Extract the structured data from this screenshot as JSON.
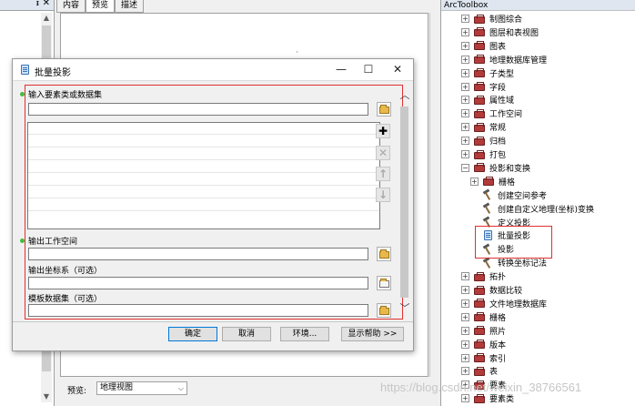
{
  "left_pane": {
    "pin_glyph": "ᵻ",
    "close_glyph": "✕",
    "up": "▲",
    "down": "▼"
  },
  "center_pane": {
    "tabs": [
      {
        "label": "内容",
        "active": false
      },
      {
        "label": "预览",
        "active": true
      },
      {
        "label": "描述",
        "active": false
      }
    ],
    "footer": {
      "preview_label": "预览:",
      "preview_value": "地理视图",
      "chevron": "⌵"
    },
    "placeholder_mark": "·"
  },
  "toolbox": {
    "title": "ArcToolbox",
    "items": [
      {
        "label": "制图综合",
        "expander": "+",
        "icon": "toolbox-icon"
      },
      {
        "label": "图层和表视图",
        "expander": "+",
        "icon": "toolbox-icon"
      },
      {
        "label": "图表",
        "expander": "+",
        "icon": "toolbox-icon"
      },
      {
        "label": "地理数据库管理",
        "expander": "+",
        "icon": "toolbox-icon"
      },
      {
        "label": "子类型",
        "expander": "+",
        "icon": "toolbox-icon"
      },
      {
        "label": "字段",
        "expander": "+",
        "icon": "toolbox-icon"
      },
      {
        "label": "属性域",
        "expander": "+",
        "icon": "toolbox-icon"
      },
      {
        "label": "工作空间",
        "expander": "+",
        "icon": "toolbox-icon"
      },
      {
        "label": "常规",
        "expander": "+",
        "icon": "toolbox-icon"
      },
      {
        "label": "归档",
        "expander": "+",
        "icon": "toolbox-icon"
      },
      {
        "label": "打包",
        "expander": "+",
        "icon": "toolbox-icon"
      },
      {
        "label": "投影和变换",
        "expander": "−",
        "icon": "toolbox-icon"
      },
      {
        "label": "栅格",
        "expander": "+",
        "icon": "toolbox-icon",
        "indent": 1
      },
      {
        "label": "创建空间参考",
        "expander": "",
        "icon": "hammer-icon",
        "indent": 2
      },
      {
        "label": "创建自定义地理(坐标)变换",
        "expander": "",
        "icon": "hammer-icon",
        "indent": 2
      },
      {
        "label": "定义投影",
        "expander": "",
        "icon": "hammer-icon",
        "indent": 2
      },
      {
        "label": "批量投影",
        "expander": "",
        "icon": "script-icon",
        "indent": 2
      },
      {
        "label": "投影",
        "expander": "",
        "icon": "hammer-icon",
        "indent": 2
      },
      {
        "label": "转换坐标记法",
        "expander": "",
        "icon": "hammer-icon",
        "indent": 2
      },
      {
        "label": "拓扑",
        "expander": "+",
        "icon": "toolbox-icon"
      },
      {
        "label": "数据比较",
        "expander": "+",
        "icon": "toolbox-icon"
      },
      {
        "label": "文件地理数据库",
        "expander": "+",
        "icon": "toolbox-icon"
      },
      {
        "label": "栅格",
        "expander": "+",
        "icon": "toolbox-icon"
      },
      {
        "label": "照片",
        "expander": "+",
        "icon": "toolbox-icon"
      },
      {
        "label": "版本",
        "expander": "+",
        "icon": "toolbox-icon"
      },
      {
        "label": "索引",
        "expander": "+",
        "icon": "toolbox-icon"
      },
      {
        "label": "表",
        "expander": "+",
        "icon": "toolbox-icon"
      },
      {
        "label": "要素",
        "expander": "+",
        "icon": "toolbox-icon"
      },
      {
        "label": "要素类",
        "expander": "+",
        "icon": "toolbox-icon"
      }
    ],
    "watermark": "https://blog.csdn.net/weixin_38766561"
  },
  "dialog": {
    "title": "批量投影",
    "window_buttons": {
      "minimize": "—",
      "maximize": "☐",
      "close": "✕"
    },
    "params": {
      "input_label": "输入要素类或数据集",
      "workspace_label": "输出工作空间",
      "coord_label": "输出坐标系（可选）",
      "template_label": "模板数据集（可选）"
    },
    "side_buttons": [
      {
        "glyph": "✚",
        "name": "add-row-button",
        "state": "active"
      },
      {
        "glyph": "✕",
        "name": "remove-row-button",
        "state": "disabled"
      },
      {
        "glyph": "↑",
        "name": "move-up-button",
        "state": "disabled"
      },
      {
        "glyph": "↓",
        "name": "move-down-button",
        "state": "disabled"
      }
    ],
    "scroll": {
      "up": "︿",
      "down": "﹀"
    },
    "footer_buttons": {
      "ok": "确定",
      "cancel": "取消",
      "env": "环境...",
      "help": "显示帮助 >>"
    }
  },
  "colors": {
    "highlight": "#e03030",
    "required_dot": "#3fbf3f"
  }
}
